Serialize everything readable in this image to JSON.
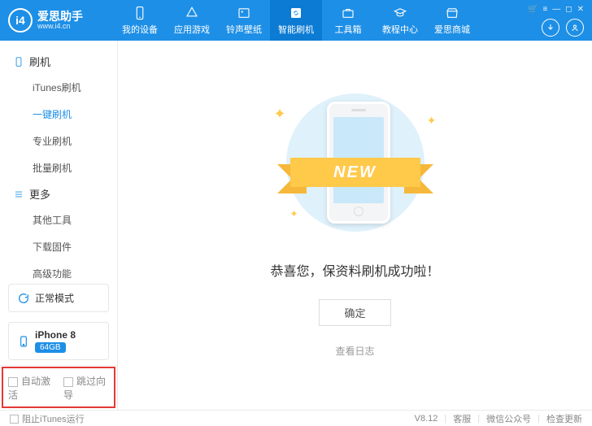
{
  "brand": {
    "name": "爱思助手",
    "site": "www.i4.cn",
    "logo_letters": "i4"
  },
  "nav": {
    "items": [
      {
        "label": "我的设备"
      },
      {
        "label": "应用游戏"
      },
      {
        "label": "铃声壁纸"
      },
      {
        "label": "智能刷机"
      },
      {
        "label": "工具箱"
      },
      {
        "label": "教程中心"
      },
      {
        "label": "爱思商城"
      }
    ],
    "active_index": 3
  },
  "sys_buttons": [
    "🛒",
    "≡",
    "—",
    "◻",
    "✕"
  ],
  "sidebar": {
    "groups": [
      {
        "title": "刷机",
        "glyph": "phone",
        "items": [
          "iTunes刷机",
          "一键刷机",
          "专业刷机",
          "批量刷机"
        ],
        "active_index": 1
      },
      {
        "title": "更多",
        "glyph": "menu",
        "items": [
          "其他工具",
          "下载固件",
          "高级功能"
        ],
        "active_index": -1
      }
    ]
  },
  "mode": {
    "label": "正常模式"
  },
  "device": {
    "name": "iPhone 8",
    "capacity": "64GB"
  },
  "footer_checks": [
    "自动激活",
    "跳过向导"
  ],
  "content": {
    "ribbon": "NEW",
    "success": "恭喜您，保资料刷机成功啦！",
    "ok": "确定",
    "log": "查看日志"
  },
  "statusbar": {
    "block_itunes": "阻止iTunes运行",
    "version": "V8.12",
    "links": [
      "客服",
      "微信公众号",
      "检查更新"
    ]
  }
}
